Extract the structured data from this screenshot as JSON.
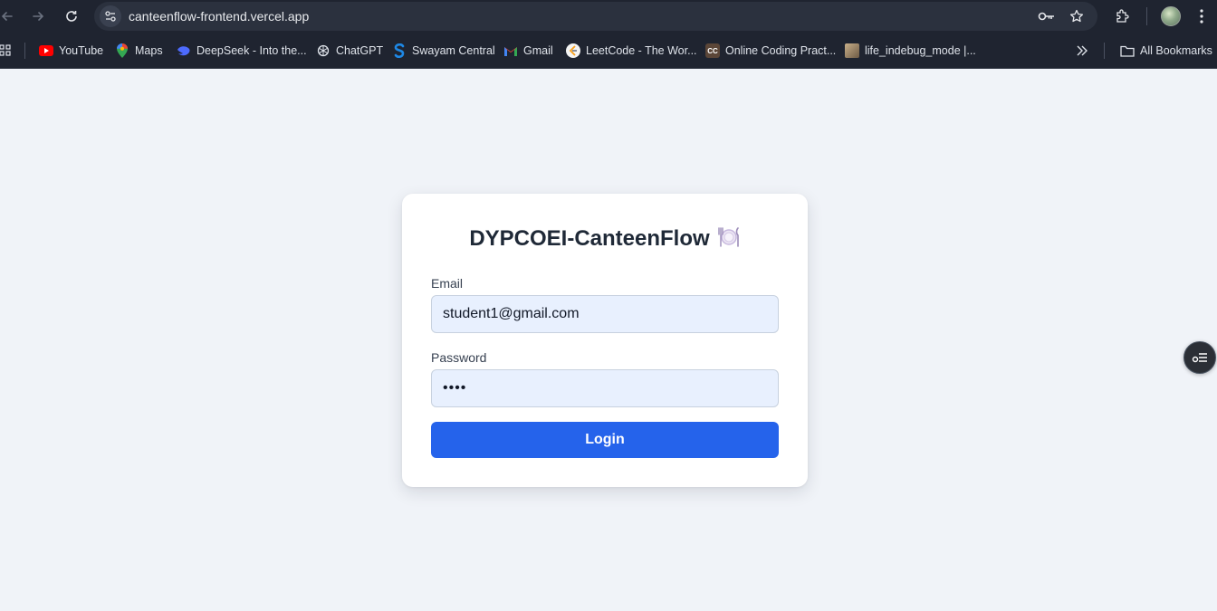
{
  "browser": {
    "url": "canteenflow-frontend.vercel.app",
    "bookmarks": [
      {
        "label": "YouTube",
        "icon": "youtube-icon"
      },
      {
        "label": "Maps",
        "icon": "maps-icon"
      },
      {
        "label": "DeepSeek - Into the...",
        "icon": "deepseek-icon"
      },
      {
        "label": "ChatGPT",
        "icon": "chatgpt-icon"
      },
      {
        "label": "Swayam Central",
        "icon": "swayam-icon"
      },
      {
        "label": "Gmail",
        "icon": "gmail-icon"
      },
      {
        "label": "LeetCode - The Wor...",
        "icon": "leetcode-icon"
      },
      {
        "label": "Online Coding Pract...",
        "icon": "codechef-icon"
      },
      {
        "label": "life_indebug_mode |...",
        "icon": "bookmark-image-icon"
      }
    ],
    "all_bookmarks_label": "All Bookmarks"
  },
  "login": {
    "title": "DYPCOEI-CanteenFlow",
    "email_label": "Email",
    "email_value": "student1@gmail.com",
    "password_label": "Password",
    "password_value": "1234",
    "button_label": "Login"
  },
  "colors": {
    "page_bg": "#f0f3f8",
    "primary_button": "#2563eb",
    "input_autofill_bg": "#e8f0fe",
    "browser_chrome": "#1f2430"
  }
}
